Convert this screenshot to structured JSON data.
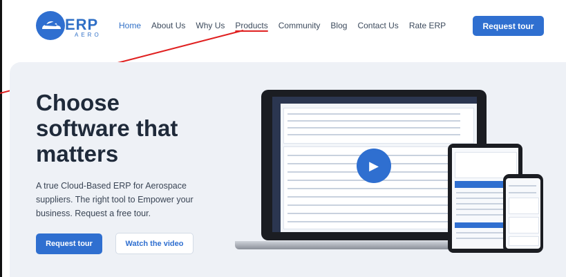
{
  "logo": {
    "text": "ERP",
    "subtext": "AERO"
  },
  "nav": {
    "items": [
      "Home",
      "About Us",
      "Why Us",
      "Products",
      "Community",
      "Blog",
      "Contact Us",
      "Rate ERP"
    ],
    "cta": "Request tour"
  },
  "hero": {
    "headline_lines": [
      "Choose",
      "software that",
      "matters"
    ],
    "subtitle_lines": [
      "A true Cloud-Based ERP for Aerospace",
      "suppliers. The right tool to Empower your",
      "business. Request a free tour."
    ],
    "primary_button": "Request tour",
    "secondary_button": "Watch the video"
  },
  "colors": {
    "accent": "#2f6fd0",
    "hero_bg": "#eef1f6",
    "annotation": "#e02020"
  },
  "icons": {
    "play": "play-icon",
    "logo": "airplane-cloud-icon"
  }
}
